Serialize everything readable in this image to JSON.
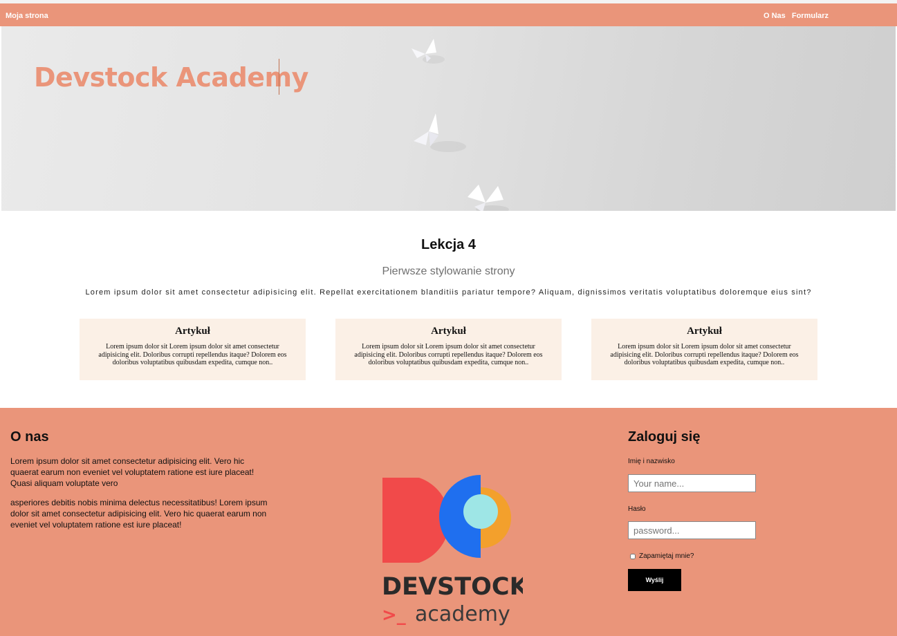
{
  "nav": {
    "brand": "Moja strona",
    "links": [
      "O Nas",
      "Formularz"
    ]
  },
  "hero": {
    "title": "Devstock Academy"
  },
  "main": {
    "title": "Lekcja 4",
    "subtitle": "Pierwsze stylowanie strony",
    "lorem": "Lorem ipsum dolor sit amet consectetur adipisicing elit. Repellat exercitationem blanditiis pariatur tempore? Aliquam, dignissimos veritatis voluptatibus doloremque eius sint?",
    "cards": [
      {
        "title": "Artykuł",
        "text": "Lorem ipsum dolor sit Lorem ipsum dolor sit amet consectetur adipisicing elit. Doloribus corrupti repellendus itaque? Dolorem eos doloribus voluptatibus quibusdam expedita, cumque non.."
      },
      {
        "title": "Artykuł",
        "text": "Lorem ipsum dolor sit Lorem ipsum dolor sit amet consectetur adipisicing elit. Doloribus corrupti repellendus itaque? Dolorem eos doloribus voluptatibus quibusdam expedita, cumque non.."
      },
      {
        "title": "Artykuł",
        "text": "Lorem ipsum dolor sit Lorem ipsum dolor sit amet consectetur adipisicing elit. Doloribus corrupti repellendus itaque? Dolorem eos doloribus voluptatibus quibusdam expedita, cumque non.."
      }
    ]
  },
  "footer": {
    "about_title": "O nas",
    "about_p1": "Lorem ipsum dolor sit amet consectetur adipisicing elit. Vero hic quaerat earum non eveniet vel voluptatem ratione est iure placeat! Quasi aliquam voluptate vero",
    "about_p2": "asperiores debitis nobis minima delectus necessitatibus! Lorem ipsum dolor sit amet consectetur adipisicing elit. Vero hic quaerat earum non eveniet vel voluptatem ratione est iure placeat!",
    "logo": {
      "word1": "DEVSTOCK",
      "prompt": ">_",
      "word2": "academy",
      "icon": "devstock-ds-logo-icon"
    },
    "login": {
      "title": "Zaloguj się",
      "name_label": "Imię i nazwisko",
      "name_placeholder": "Your name...",
      "password_label": "Hasło",
      "password_placeholder": "password...",
      "remember_label": "Zapamiętaj mnie?",
      "submit_label": "Wyślij"
    }
  },
  "colors": {
    "accent": "#ea957a",
    "card_bg": "#fbf0e6",
    "logo_red": "#f14a4a",
    "logo_blue": "#1f6fef",
    "logo_orange": "#f3a02c",
    "logo_cyan": "#9ee6e6"
  }
}
